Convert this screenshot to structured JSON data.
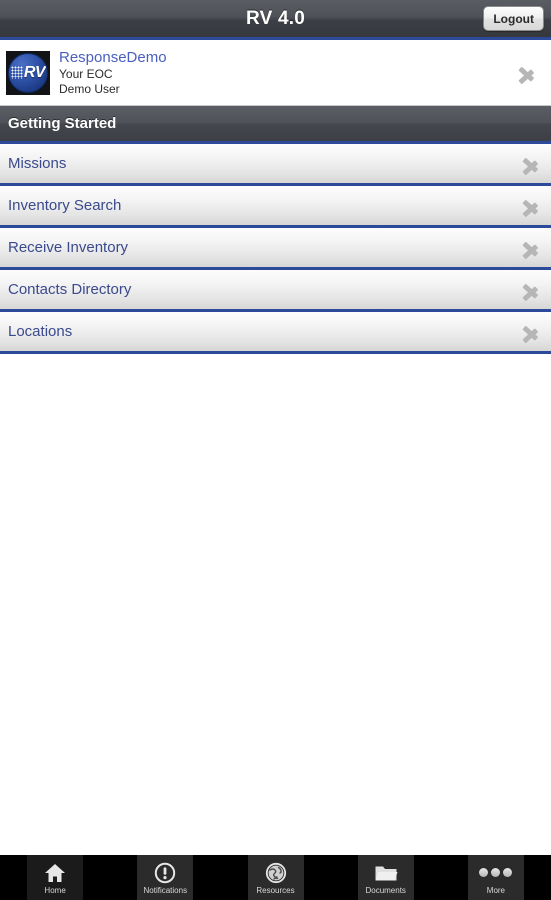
{
  "titlebar": {
    "title": "RV 4.0",
    "logout_label": "Logout"
  },
  "account": {
    "org_name": "ResponseDemo",
    "eoc": "Your EOC",
    "user": "Demo User",
    "logo_text": "RV"
  },
  "section": {
    "header": "Getting Started"
  },
  "menu": {
    "items": [
      {
        "label": "Missions"
      },
      {
        "label": "Inventory Search"
      },
      {
        "label": "Receive Inventory"
      },
      {
        "label": "Contacts Directory"
      },
      {
        "label": "Locations"
      }
    ]
  },
  "tabbar": {
    "tabs": [
      {
        "label": "Home",
        "icon": "home-icon"
      },
      {
        "label": "Notifications",
        "icon": "alert-circle-icon"
      },
      {
        "label": "Resources",
        "icon": "globe-icon"
      },
      {
        "label": "Documents",
        "icon": "folder-icon"
      },
      {
        "label": "More",
        "icon": "ellipsis-icon"
      }
    ]
  },
  "colors": {
    "accent_blue": "#2c4a99",
    "link_blue": "#3a4a8c",
    "header_gray": "#4f5258"
  }
}
